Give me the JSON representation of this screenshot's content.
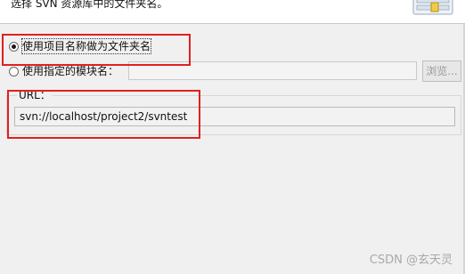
{
  "header": {
    "description": "选择 SVN 资源库中的文件夹名。",
    "icon": "wizard-banner-icon"
  },
  "options": {
    "use_project_name": {
      "label": "使用项目名称做为文件夹名",
      "selected": true
    },
    "use_module_name": {
      "label": "使用指定的模块名：",
      "selected": false
    }
  },
  "module_input": {
    "value": "",
    "enabled": false
  },
  "browse_button": {
    "label": "浏览...",
    "enabled": false
  },
  "url_group": {
    "legend": "URL：",
    "value": "svn://localhost/project2/svntest"
  },
  "annotation_color": "#e02020",
  "watermark": "CSDN @玄天灵"
}
